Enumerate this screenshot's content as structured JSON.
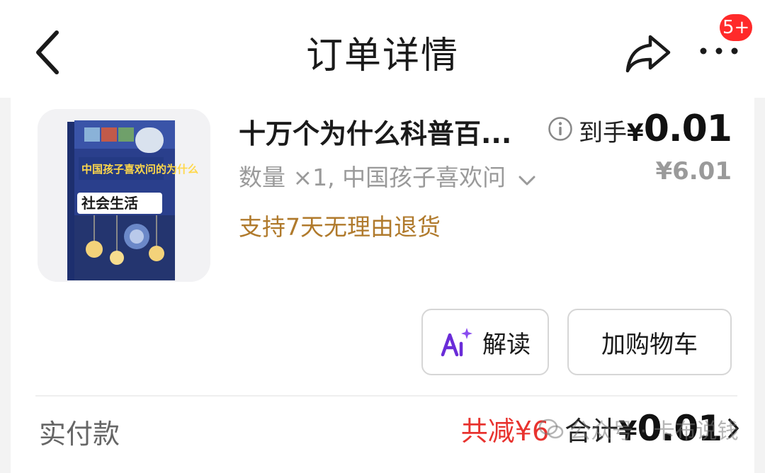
{
  "header": {
    "title": "订单详情",
    "notification_badge": "5+",
    "icons": [
      "back-chevron-icon",
      "share-icon",
      "more-dots-icon"
    ]
  },
  "product": {
    "image_label": "book-cover",
    "cover_text": {
      "series": "中国孩子喜欢问的为什么",
      "subtitle": "社会生活"
    },
    "name": "十万个为什么科普百...",
    "spec_text": "数量 ×1, 中国孩子喜欢问",
    "return_policy": "支持7天无理由退货",
    "price_label": "到手",
    "price_currency": "¥",
    "price_value": "0.01",
    "original_price": "¥6.01"
  },
  "actions": {
    "ai_button_label": "解读",
    "cart_button_label": "加购物车"
  },
  "summary": {
    "paid_label": "实付款",
    "discount": "共减¥6",
    "total_label": "合计",
    "total_currency": "¥",
    "total_value": "0.01"
  },
  "watermark": {
    "text": "公众号 · 卡布说钱"
  },
  "colors": {
    "accent_red": "#ff2a2a",
    "discount_red": "#e8332f",
    "return_policy_brown": "#b07a2c",
    "ai_purple": "#6a2cd8"
  }
}
